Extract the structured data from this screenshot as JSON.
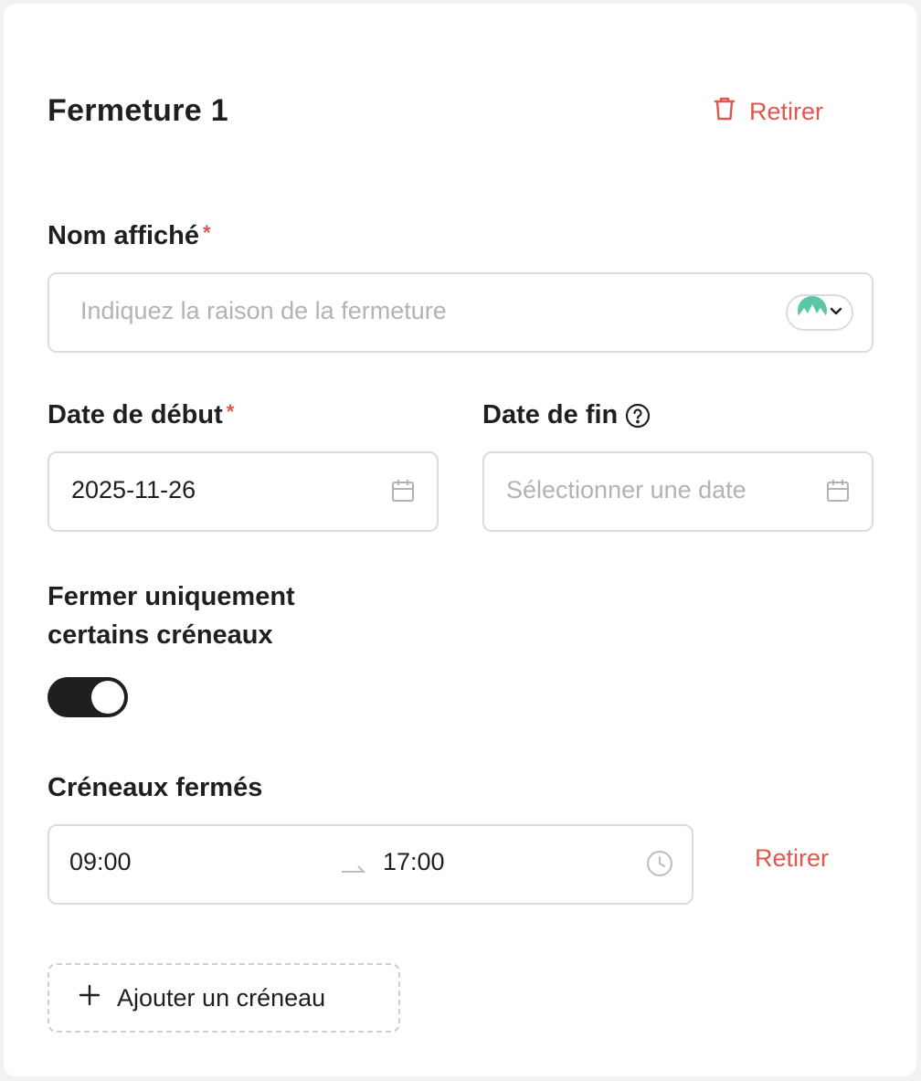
{
  "header": {
    "title": "Fermeture 1",
    "remove_label": "Retirer"
  },
  "display_name": {
    "label": "Nom affiché",
    "required_mark": "*",
    "placeholder": "Indiquez la raison de la fermeture",
    "value": "",
    "language_icon": "flag-icon"
  },
  "start_date": {
    "label": "Date de début",
    "required_mark": "*",
    "value": "2025-11-26",
    "placeholder": ""
  },
  "end_date": {
    "label": "Date de fin",
    "placeholder": "Sélectionner une date",
    "value": ""
  },
  "partial": {
    "label_line1": "Fermer uniquement",
    "label_line2": "certains créneaux",
    "enabled": true
  },
  "slots": {
    "label": "Créneaux fermés",
    "items": [
      {
        "start": "09:00",
        "end": "17:00",
        "remove_label": "Retirer"
      }
    ],
    "add_label": "Ajouter un créneau"
  },
  "colors": {
    "accent_red": "#e2574c",
    "toggle_on": "#1f1f1f",
    "flag_teal": "#5cc7a8"
  }
}
